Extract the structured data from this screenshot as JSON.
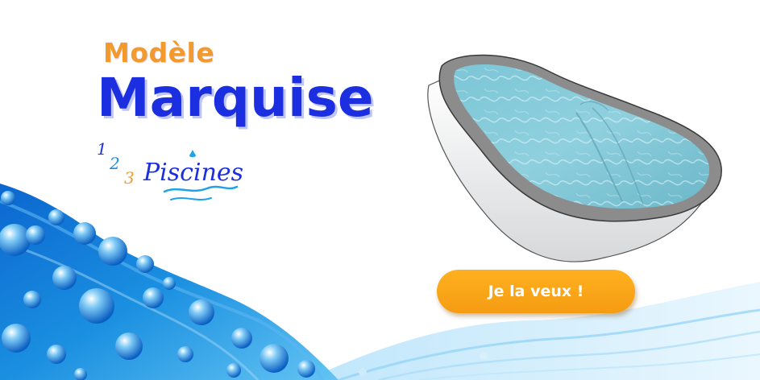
{
  "heading": {
    "eyebrow": "Modèle",
    "title": "Marquise"
  },
  "logo": {
    "digit_1": "1",
    "digit_2": "2",
    "digit_3": "3",
    "wordmark": "Piscines"
  },
  "cta": {
    "label": "Je la veux !"
  },
  "colors": {
    "title_blue": "#1b2fe0",
    "eyebrow_orange": "#f39a2e",
    "button_orange": "#f7a416",
    "water_blue": "#1a8fe0"
  },
  "images": {
    "pool": "pool-illustration",
    "background": "water-splash-bubbles"
  }
}
